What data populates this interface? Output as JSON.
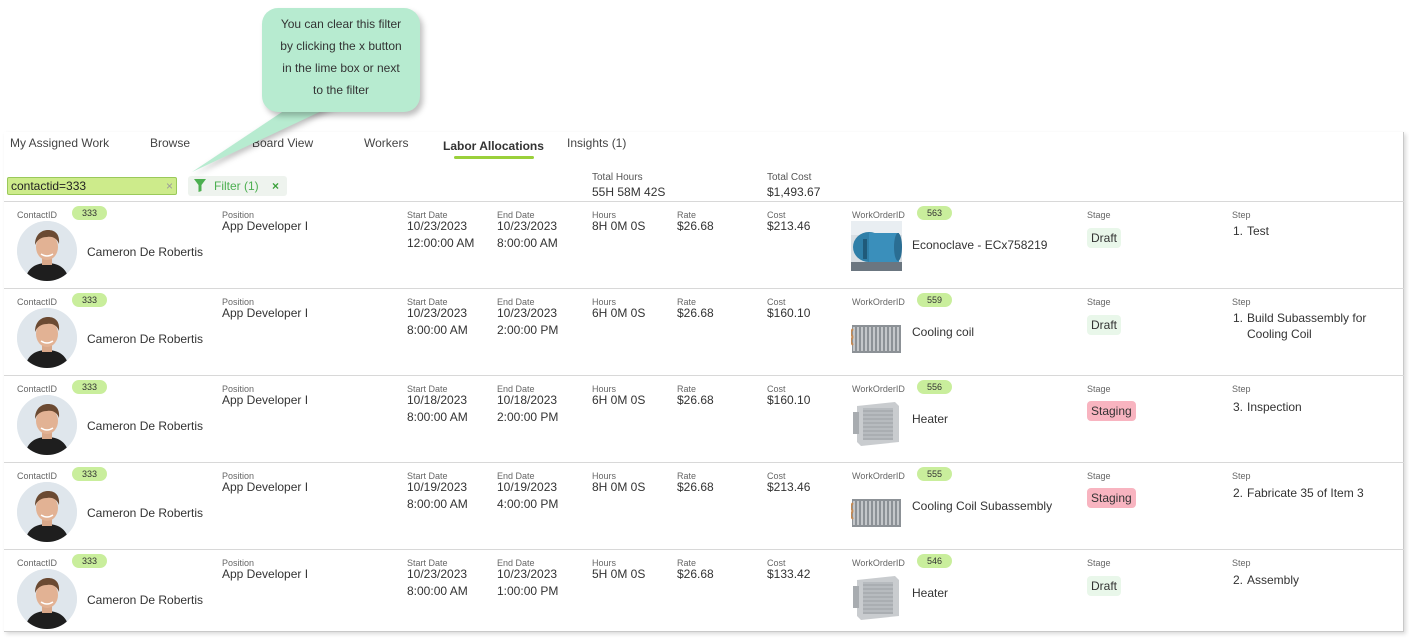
{
  "callout": {
    "lines": [
      "You can clear this filter",
      "by clicking the x button",
      "in the lime box or next",
      "to the filter"
    ]
  },
  "tabs": [
    {
      "label": "My Assigned Work",
      "active": false
    },
    {
      "label": "Browse",
      "active": false
    },
    {
      "label": "Board View",
      "active": false
    },
    {
      "label": "Workers",
      "active": false
    },
    {
      "label": "Labor Allocations",
      "active": true
    },
    {
      "label": "Insights (1)",
      "active": false
    }
  ],
  "filter": {
    "value": "contactid=333",
    "clear_glyph": "×",
    "chip_label": "Filter (1)",
    "chip_clear_glyph": "×"
  },
  "totals": {
    "hours_label": "Total Hours",
    "hours_value": "55H 58M 42S",
    "cost_label": "Total Cost",
    "cost_value": "$1,493.67"
  },
  "labels": {
    "contact_id": "ContactID",
    "position": "Position",
    "start_date": "Start Date",
    "end_date": "End Date",
    "hours": "Hours",
    "rate": "Rate",
    "cost": "Cost",
    "work_order_id": "WorkOrderID",
    "stage": "Stage",
    "step": "Step"
  },
  "colors": {
    "accent_lime": "#c9ee9c",
    "tab_underline": "#9ad03b",
    "callout_bg": "#b7ebd0",
    "draft_bg": "#e9f7ea",
    "staging_bg": "#f8b4c0"
  },
  "rows": [
    {
      "contact_id": "333",
      "name": "Cameron De Robertis",
      "position": "App Developer I",
      "start_date": "10/23/2023",
      "start_time": "12:00:00 AM",
      "end_date": "10/23/2023",
      "end_time": "8:00:00 AM",
      "hours": "8H 0M 0S",
      "rate": "$26.68",
      "cost": "$213.46",
      "work_order_id": "563",
      "work_order_name": "Econoclave - ECx758219",
      "thumb_icon": "autoclave-image",
      "stage": "Draft",
      "stage_kind": "draft",
      "step_num": "1.",
      "step_text": "Test"
    },
    {
      "contact_id": "333",
      "name": "Cameron De Robertis",
      "position": "App Developer I",
      "start_date": "10/23/2023",
      "start_time": "8:00:00 AM",
      "end_date": "10/23/2023",
      "end_time": "2:00:00 PM",
      "hours": "6H 0M 0S",
      "rate": "$26.68",
      "cost": "$160.10",
      "work_order_id": "559",
      "work_order_name": "Cooling coil",
      "thumb_icon": "cooling-coil-image",
      "stage": "Draft",
      "stage_kind": "draft",
      "step_num": "1.",
      "step_text": "Build Subassembly for Cooling Coil"
    },
    {
      "contact_id": "333",
      "name": "Cameron De Robertis",
      "position": "App Developer I",
      "start_date": "10/18/2023",
      "start_time": "8:00:00 AM",
      "end_date": "10/18/2023",
      "end_time": "2:00:00 PM",
      "hours": "6H 0M 0S",
      "rate": "$26.68",
      "cost": "$160.10",
      "work_order_id": "556",
      "work_order_name": "Heater",
      "thumb_icon": "heater-image",
      "stage": "Staging",
      "stage_kind": "staging",
      "step_num": "3.",
      "step_text": "Inspection"
    },
    {
      "contact_id": "333",
      "name": "Cameron De Robertis",
      "position": "App Developer I",
      "start_date": "10/19/2023",
      "start_time": "8:00:00 AM",
      "end_date": "10/19/2023",
      "end_time": "4:00:00 PM",
      "hours": "8H 0M 0S",
      "rate": "$26.68",
      "cost": "$213.46",
      "work_order_id": "555",
      "work_order_name": "Cooling Coil Subassembly",
      "thumb_icon": "cooling-coil-image",
      "stage": "Staging",
      "stage_kind": "staging",
      "step_num": "2.",
      "step_text": "Fabricate 35 of Item 3"
    },
    {
      "contact_id": "333",
      "name": "Cameron De Robertis",
      "position": "App Developer I",
      "start_date": "10/23/2023",
      "start_time": "8:00:00 AM",
      "end_date": "10/23/2023",
      "end_time": "1:00:00 PM",
      "hours": "5H 0M 0S",
      "rate": "$26.68",
      "cost": "$133.42",
      "work_order_id": "546",
      "work_order_name": "Heater",
      "thumb_icon": "heater-image",
      "stage": "Draft",
      "stage_kind": "draft",
      "step_num": "2.",
      "step_text": "Assembly"
    }
  ]
}
